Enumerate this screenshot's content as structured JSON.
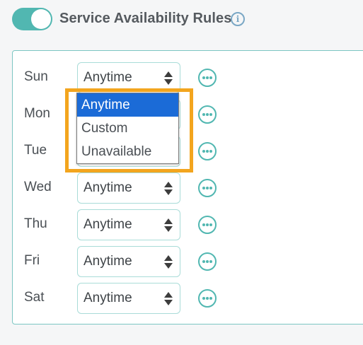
{
  "header": {
    "toggle_state": "on",
    "title": "Service Availability Rules",
    "info_icon": "info-icon"
  },
  "colors": {
    "accent": "#51b7b1",
    "select_highlight": "#1b6bd7",
    "annotation": "#f3a51e"
  },
  "rows": [
    {
      "day": "Sun",
      "value": "Anytime"
    },
    {
      "day": "Mon",
      "value": ""
    },
    {
      "day": "Tue",
      "value": ""
    },
    {
      "day": "Wed",
      "value": "Anytime"
    },
    {
      "day": "Thu",
      "value": "Anytime"
    },
    {
      "day": "Fri",
      "value": "Anytime"
    },
    {
      "day": "Sat",
      "value": "Anytime"
    }
  ],
  "dropdown": {
    "options": [
      "Anytime",
      "Custom",
      "Unavailable"
    ],
    "selected": "Anytime"
  }
}
